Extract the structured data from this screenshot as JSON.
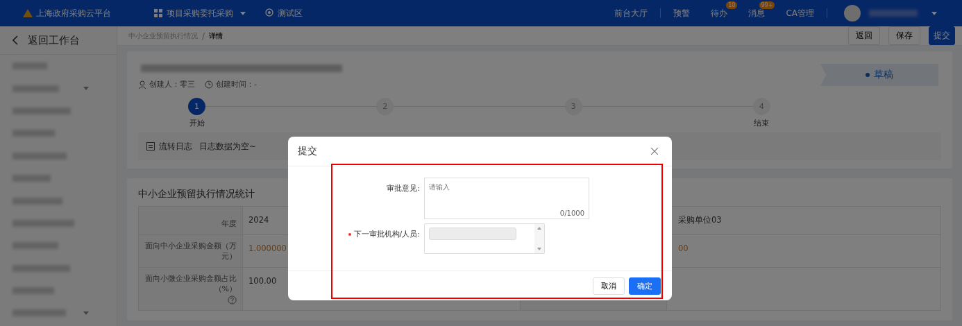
{
  "header": {
    "platform": "上海政府采购云平台",
    "module": "项目采购委托采购",
    "region": "测试区",
    "nav": [
      {
        "label": "前台大厅"
      },
      {
        "label": "预警"
      },
      {
        "label": "待办",
        "badge": "10"
      },
      {
        "label": "消息",
        "badge": "99+"
      },
      {
        "label": "CA管理"
      }
    ]
  },
  "sidebar": {
    "back": "返回工作台",
    "items": [
      {
        "has_submenu": false
      },
      {
        "has_submenu": true
      },
      {
        "has_submenu": false
      },
      {
        "has_submenu": false
      },
      {
        "has_submenu": false
      },
      {
        "has_submenu": false
      },
      {
        "has_submenu": false
      },
      {
        "has_submenu": false
      },
      {
        "has_submenu": false
      },
      {
        "has_submenu": false
      },
      {
        "has_submenu": false
      },
      {
        "has_submenu": true
      }
    ]
  },
  "breadcrumb": {
    "parent": "中小企业预留执行情况",
    "separator": "/",
    "current": "详情"
  },
  "toolbar": [
    {
      "label": "返回",
      "primary": false
    },
    {
      "label": "保存",
      "primary": false
    },
    {
      "label": "提交",
      "primary": true
    }
  ],
  "detail": {
    "creator": "创建人：零三",
    "created_time": "创建时间：-",
    "status": "草稿",
    "steps": [
      {
        "number": "1",
        "label": "开始",
        "active": true
      },
      {
        "number": "2",
        "active": false
      },
      {
        "number": "3",
        "active": false
      },
      {
        "number": "4",
        "label": "结束",
        "active": false
      }
    ],
    "log_title": "流转日志",
    "log_empty": "日志数据为空~"
  },
  "stats": {
    "title": "中小企业预留执行情况统计",
    "rows": [
      {
        "label": "年度",
        "value": "2024",
        "highlight": false,
        "help": false,
        "right_value": "采购单位03"
      },
      {
        "label": "面向中小企业采购金额（万元）",
        "value": "1.000000",
        "highlight": true,
        "help": false,
        "right_value": "00"
      },
      {
        "label": "面向小微企业采购金额占比（%）",
        "value": "100.00",
        "highlight": false,
        "help": true,
        "right_value": null
      }
    ]
  },
  "dialog": {
    "title": "提交",
    "opinion_label": "审批意见:",
    "opinion_placeholder": "请输入",
    "counter": "0/1000",
    "next_label": "下一审批机构/人员:",
    "next_required": true,
    "buttons": [
      {
        "label": "取消",
        "primary": false
      },
      {
        "label": "确定",
        "primary": true
      }
    ]
  }
}
